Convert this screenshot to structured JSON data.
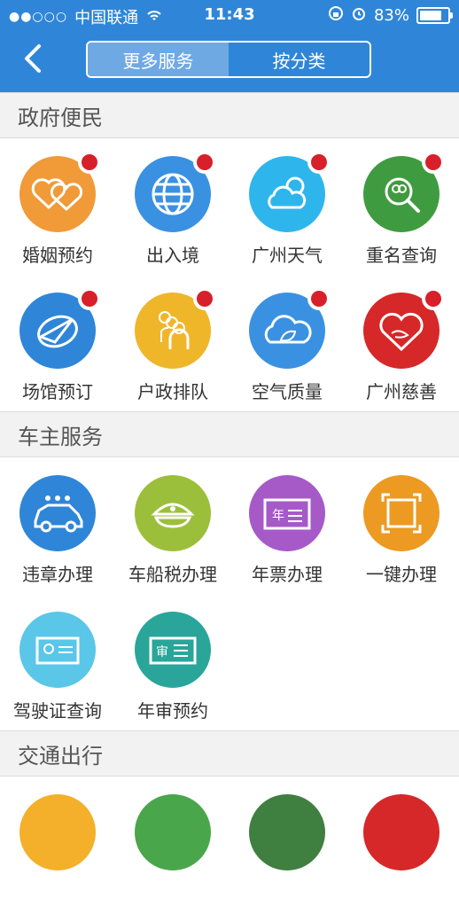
{
  "status_bar": {
    "signal": "●●○○○",
    "carrier": "中国联通",
    "time": "11:43",
    "battery": "83%"
  },
  "nav": {
    "segments": [
      "更多服务",
      "按分类"
    ],
    "active_index": 0
  },
  "sections": [
    {
      "title": "政府便民",
      "items": [
        {
          "label": "婚姻预约",
          "color": "#f09a38",
          "icon": "hearts-icon",
          "badge": true
        },
        {
          "label": "出入境",
          "color": "#3a91e2",
          "icon": "globe-icon",
          "badge": true
        },
        {
          "label": "广州天气",
          "color": "#2eb6ec",
          "icon": "weather-icon",
          "badge": true
        },
        {
          "label": "重名查询",
          "color": "#3f9b3f",
          "icon": "people-search-icon",
          "badge": true
        },
        {
          "label": "场馆预订",
          "color": "#2f86d8",
          "icon": "stadium-icon",
          "badge": true
        },
        {
          "label": "户政排队",
          "color": "#efb62a",
          "icon": "queue-icon",
          "badge": true
        },
        {
          "label": "空气质量",
          "color": "#3a91e2",
          "icon": "cloud-leaf-icon",
          "badge": true
        },
        {
          "label": "广州慈善",
          "color": "#d62828",
          "icon": "heart-hand-icon",
          "badge": true
        }
      ]
    },
    {
      "title": "车主服务",
      "items": [
        {
          "label": "违章办理",
          "color": "#2f86d8",
          "icon": "car-icon",
          "badge": false
        },
        {
          "label": "车船税办理",
          "color": "#9cbf3b",
          "icon": "police-cap-icon",
          "badge": false
        },
        {
          "label": "年票办理",
          "color": "#a65ac8",
          "icon": "annual-ticket-icon",
          "badge": false
        },
        {
          "label": "一键办理",
          "color": "#ec9a22",
          "icon": "frame-icon",
          "badge": false
        },
        {
          "label": "驾驶证查询",
          "color": "#5ac6e8",
          "icon": "license-card-icon",
          "badge": false
        },
        {
          "label": "年审预约",
          "color": "#2aa59a",
          "icon": "inspection-card-icon",
          "badge": false
        }
      ]
    },
    {
      "title": "交通出行",
      "items": [
        {
          "label": "",
          "color": "#f4b02a",
          "icon": "transport-icon-1",
          "badge": false
        },
        {
          "label": "",
          "color": "#4aa64a",
          "icon": "transport-icon-2",
          "badge": false
        },
        {
          "label": "",
          "color": "#3f7f3f",
          "icon": "transport-icon-3",
          "badge": false
        },
        {
          "label": "",
          "color": "#d62828",
          "icon": "transport-icon-4",
          "badge": false
        }
      ]
    }
  ]
}
